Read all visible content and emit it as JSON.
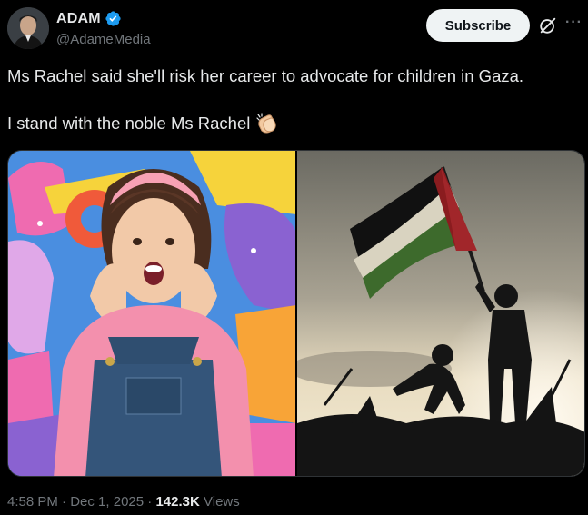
{
  "author": {
    "name": "ADAM",
    "handle": "@AdameMedia",
    "verified": true,
    "avatar_icon": "profile-photo"
  },
  "header": {
    "subscribe_label": "Subscribe",
    "grok_icon": "grok-icon",
    "more_icon": "more-icon",
    "more_glyph": "···"
  },
  "tweet": {
    "line1": "Ms Rachel said she'll risk her career to advocate for children in Gaza.",
    "line2": "I stand with the noble Ms Rachel",
    "emoji": "clapping-hands-emoji"
  },
  "media": {
    "left_image": "smiling-woman-pink-shirt-denim-overalls",
    "right_image": "silhouette-children-palestinian-flag"
  },
  "meta": {
    "time": "4:58 PM",
    "date": "Dec 1, 2025",
    "views_count": "142.3K",
    "views_label": "Views",
    "sep1": " · ",
    "sep2": " · "
  },
  "colors": {
    "background": "#000000",
    "text": "#e7e9ea",
    "secondary": "#71767b",
    "verified": "#1d9bf0",
    "subscribe_bg": "#eff3f4"
  }
}
